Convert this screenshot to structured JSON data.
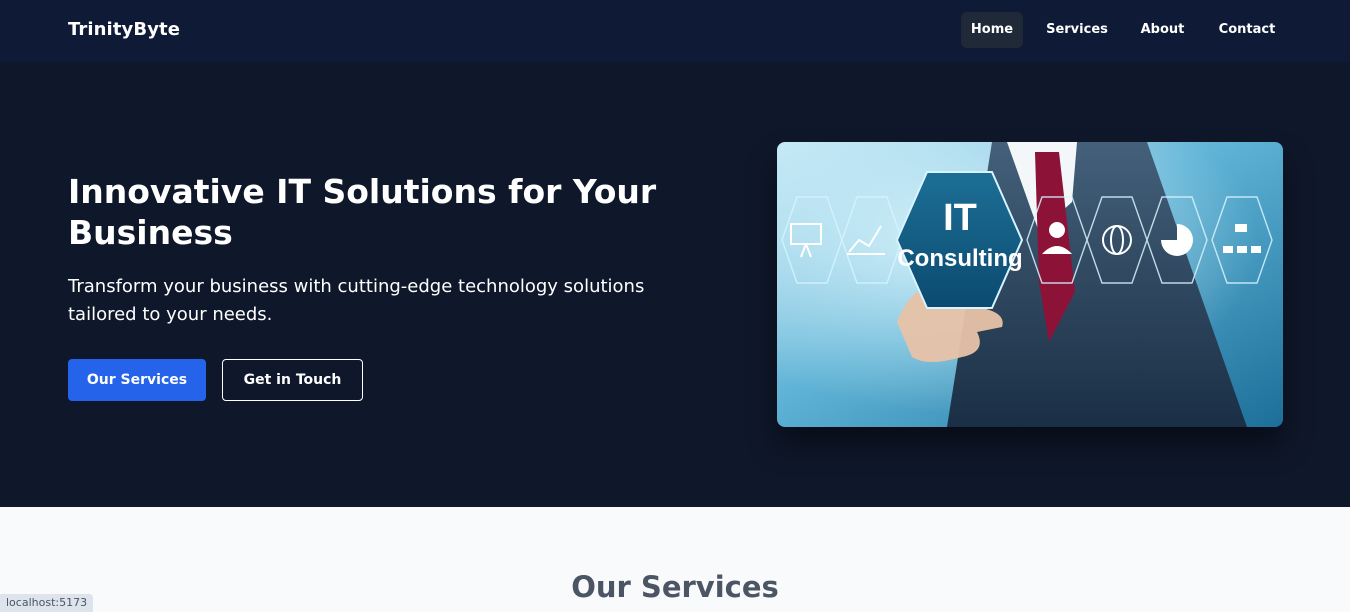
{
  "nav": {
    "brand": "TrinityByte",
    "links": [
      {
        "label": "Home",
        "active": true
      },
      {
        "label": "Services",
        "active": false
      },
      {
        "label": "About",
        "active": false
      },
      {
        "label": "Contact",
        "active": false
      }
    ]
  },
  "hero": {
    "title": "Innovative IT Solutions for Your Business",
    "subtitle": "Transform your business with cutting-edge technology solutions tailored to your needs.",
    "primary_button": "Our Services",
    "secondary_button": "Get in Touch",
    "image": {
      "line1": "IT",
      "line2": "Consulting",
      "icons": [
        "presentation-icon",
        "chart-icon",
        "person-icon",
        "globe-icon",
        "pie-chart-icon",
        "org-chart-icon"
      ]
    }
  },
  "services": {
    "heading": "Our Services"
  },
  "status_bar": {
    "url": "localhost:5173"
  },
  "colors": {
    "nav_bg": "#0f1b36",
    "hero_bg": "#0f172a",
    "primary": "#2563eb",
    "page_bg": "#f8fafc",
    "heading_gray": "#4b5563"
  }
}
